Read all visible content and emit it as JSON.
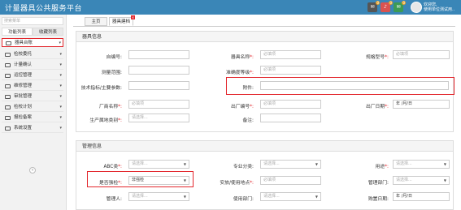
{
  "app": {
    "title": "计量器具公共服务平台"
  },
  "topbar": {
    "icons": [
      {
        "name": "mail-icon",
        "color": "#555555",
        "badge": "0"
      },
      {
        "name": "bell-icon",
        "color": "#d9534f",
        "badge": "0"
      },
      {
        "name": "envelope-icon",
        "color": "#3c9b54",
        "badge": "0"
      }
    ],
    "user_line1": "欢迎您,",
    "user_line2": "使用单位测试用.."
  },
  "sidebar": {
    "search_placeholder": "搜索菜单",
    "tabs": [
      "功能列表",
      "收藏列表"
    ],
    "items": [
      {
        "label": "器具台账",
        "active": true
      },
      {
        "label": "检校委托"
      },
      {
        "label": "计量确认"
      },
      {
        "label": "运控管理"
      },
      {
        "label": "维修管理"
      },
      {
        "label": "审批管理"
      },
      {
        "label": "检校计划"
      },
      {
        "label": "报检备案"
      },
      {
        "label": "系统设置"
      }
    ]
  },
  "content_tabs": [
    "主页",
    "器具建档"
  ],
  "basic": {
    "header": "器具信息",
    "fields": {
      "self_no": {
        "label": "自编号:",
        "value": ""
      },
      "name": {
        "label": "器具名称",
        "placeholder": "必填项"
      },
      "spec": {
        "label": "规格型号",
        "placeholder": "必填项"
      },
      "range": {
        "label": "测量范围:",
        "value": ""
      },
      "accuracy": {
        "label": "准确度等级",
        "placeholder": "必填项"
      },
      "tech": {
        "label": "技术指标/主要参数:",
        "value": ""
      },
      "attachment": {
        "label": "附件:",
        "value": ""
      },
      "maker": {
        "label": "厂商名称",
        "placeholder": "必填项"
      },
      "factory_no": {
        "label": "出厂编号",
        "placeholder": "必填项"
      },
      "factory_date": {
        "label": "出厂日期",
        "placeholder": "年 /月/日"
      },
      "category": {
        "label": "生产属地类别",
        "placeholder": "请选择..."
      },
      "remark": {
        "label": "备注:",
        "value": ""
      }
    }
  },
  "management": {
    "header": "管理信息",
    "fields": {
      "abc": {
        "label": "ABC类",
        "placeholder": "请选择..."
      },
      "major": {
        "label": "专业分类:",
        "placeholder": "请选择..."
      },
      "usage": {
        "label": "用途",
        "placeholder": "请选择..."
      },
      "inspect": {
        "label": "是否强检",
        "value": "非强检"
      },
      "location": {
        "label": "安放/使用地点",
        "placeholder": "必填项"
      },
      "dept": {
        "label": "管理部门:",
        "placeholder": "请选择..."
      },
      "manager": {
        "label": "管理人:",
        "placeholder": "请选择..."
      },
      "use_dept": {
        "label": "使用部门:",
        "placeholder": "请选择..."
      },
      "buy_date": {
        "label": "购置日期:",
        "placeholder": "年 /月/日"
      }
    }
  },
  "colors": {
    "topbar": "#3a86b7",
    "highlight": "#e3262c",
    "required": "#e3262c"
  }
}
